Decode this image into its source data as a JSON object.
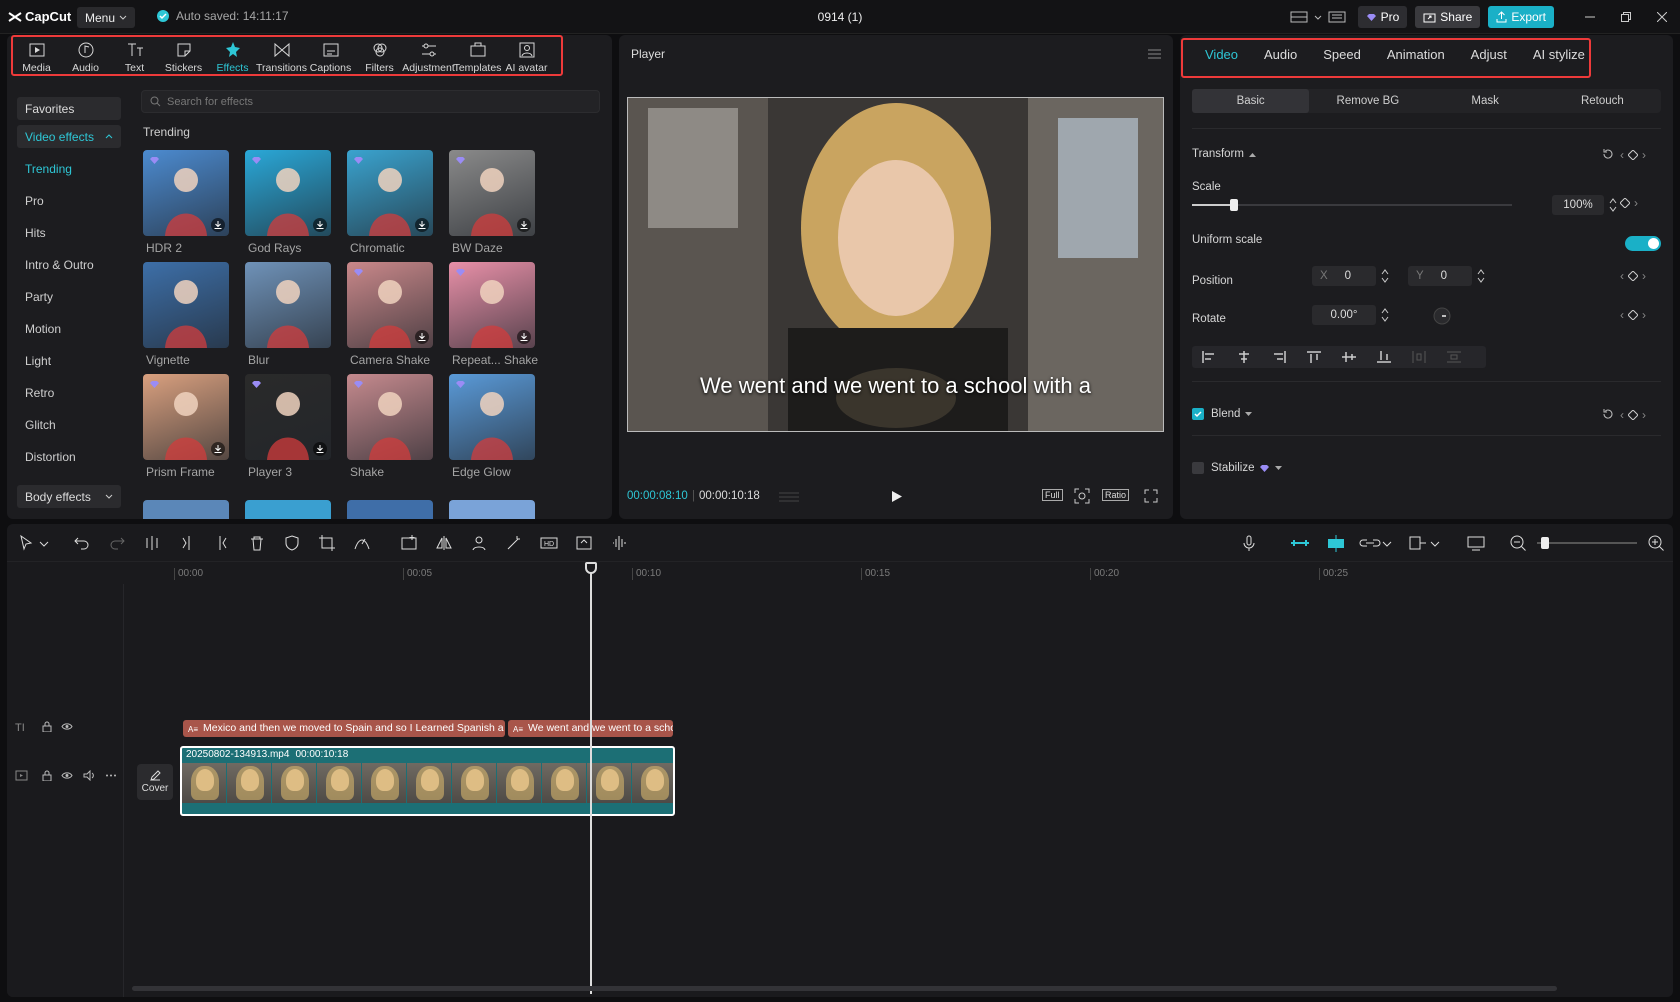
{
  "app": {
    "name": "CapCut",
    "menu_label": "Menu",
    "autosave": "Auto saved: 14:11:17",
    "project_title": "0914 (1)",
    "pro_label": "Pro",
    "share_label": "Share",
    "export_label": "Export"
  },
  "tool_tabs": [
    {
      "label": "Media",
      "icon": "media-icon"
    },
    {
      "label": "Audio",
      "icon": "audio-icon"
    },
    {
      "label": "Text",
      "icon": "text-icon"
    },
    {
      "label": "Stickers",
      "icon": "stickers-icon"
    },
    {
      "label": "Effects",
      "icon": "effects-icon",
      "active": true
    },
    {
      "label": "Transitions",
      "icon": "transitions-icon"
    },
    {
      "label": "Captions",
      "icon": "captions-icon"
    },
    {
      "label": "Filters",
      "icon": "filters-icon"
    },
    {
      "label": "Adjustment",
      "icon": "adjustment-icon"
    },
    {
      "label": "Templates",
      "icon": "templates-icon"
    },
    {
      "label": "AI avatar",
      "icon": "ai-avatar-icon"
    }
  ],
  "left_nav": {
    "favorites": "Favorites",
    "video_effects": "Video effects",
    "items": [
      "Trending",
      "Pro",
      "Hits",
      "Intro & Outro",
      "Party",
      "Motion",
      "Light",
      "Retro",
      "Glitch",
      "Distortion"
    ],
    "body_effects": "Body effects"
  },
  "search_placeholder": "Search for effects",
  "section_title": "Trending",
  "effects": [
    {
      "name": "HDR 2",
      "bg": "#4c8bd0"
    },
    {
      "name": "God Rays",
      "bg": "#2aa8d8"
    },
    {
      "name": "Chromatic",
      "bg": "#3aa3cf"
    },
    {
      "name": "BW Daze",
      "bg": "#8a8a8a"
    },
    {
      "name": "Vignette",
      "bg": "#3d6fa8"
    },
    {
      "name": "Blur",
      "bg": "#6f92b8"
    },
    {
      "name": "Camera Shake",
      "bg": "#c9888a"
    },
    {
      "name": "Repeat... Shake",
      "bg": "#e890a8"
    },
    {
      "name": "Prism Frame",
      "bg": "#d9a07f"
    },
    {
      "name": "Player 3",
      "bg": "#2a2a2a"
    },
    {
      "name": "Shake",
      "bg": "#c58a8e"
    },
    {
      "name": "Edge Glow",
      "bg": "#5a9ad8"
    }
  ],
  "player": {
    "title": "Player",
    "subtitle": "We went and we went to a school with a",
    "current_time": "00:00:08:10",
    "duration": "00:00:10:18",
    "full_label": "Full",
    "ratio_label": "Ratio"
  },
  "right_tabs": [
    "Video",
    "Audio",
    "Speed",
    "Animation",
    "Adjust",
    "AI stylize"
  ],
  "sub_tabs": [
    "Basic",
    "Remove BG",
    "Mask",
    "Retouch"
  ],
  "props": {
    "transform": "Transform",
    "scale": "Scale",
    "scale_value": "100%",
    "scale_fraction": 0.13,
    "uniform_scale": "Uniform scale",
    "position": "Position",
    "x_label": "X",
    "x_value": "0",
    "y_label": "Y",
    "y_value": "0",
    "rotate": "Rotate",
    "rotate_value": "0.00°",
    "blend": "Blend",
    "stabilize": "Stabilize"
  },
  "timeline": {
    "ticks": [
      "00:00",
      "00:05",
      "00:10",
      "00:15",
      "00:20",
      "00:25"
    ],
    "text_clip_1": "Mexico and then we moved to Spain and so I Learned Spanish a pret",
    "text_clip_2": "We went and we went to a scho",
    "video_file": "20250802-134913.mp4",
    "video_duration": "00:00:10:18",
    "cover_label": "Cover"
  },
  "colors": {
    "accent": "#2ec7d6",
    "highlight": "#ee3a3a",
    "export": "#1ab0c7"
  }
}
